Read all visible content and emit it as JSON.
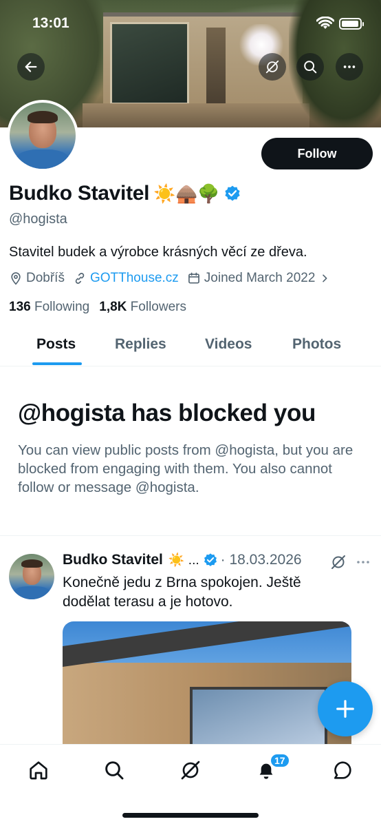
{
  "status_bar": {
    "time": "13:01"
  },
  "profile": {
    "name": "Budko Stavitel",
    "emojis": "☀️🛖🌳",
    "handle": "@hogista",
    "bio": "Stavitel budek a výrobce krásných věcí ze dřeva.",
    "location": "Dobříš",
    "website": "GOTThouse.cz",
    "joined": "Joined March 2022",
    "following_count": "136",
    "following_label": "Following",
    "followers_count": "1,8K",
    "followers_label": "Followers",
    "follow_label": "Follow"
  },
  "tabs": [
    "Posts",
    "Replies",
    "Videos",
    "Photos"
  ],
  "blocked": {
    "title": "@hogista has blocked you",
    "text": "You can view public posts from @hogista, but you are blocked from engaging with them. You also cannot follow or message @hogista."
  },
  "post": {
    "author": "Budko Stavitel",
    "author_emoji": "☀️ ...",
    "date": "18.03.2026",
    "text": "Konečně jedu z Brna spokojen. Ještě dodělat terasu a je hotovo."
  },
  "nav": {
    "notifications_badge": "17"
  },
  "colors": {
    "accent": "#1d9bf0",
    "text": "#0f1419",
    "muted": "#536471"
  }
}
